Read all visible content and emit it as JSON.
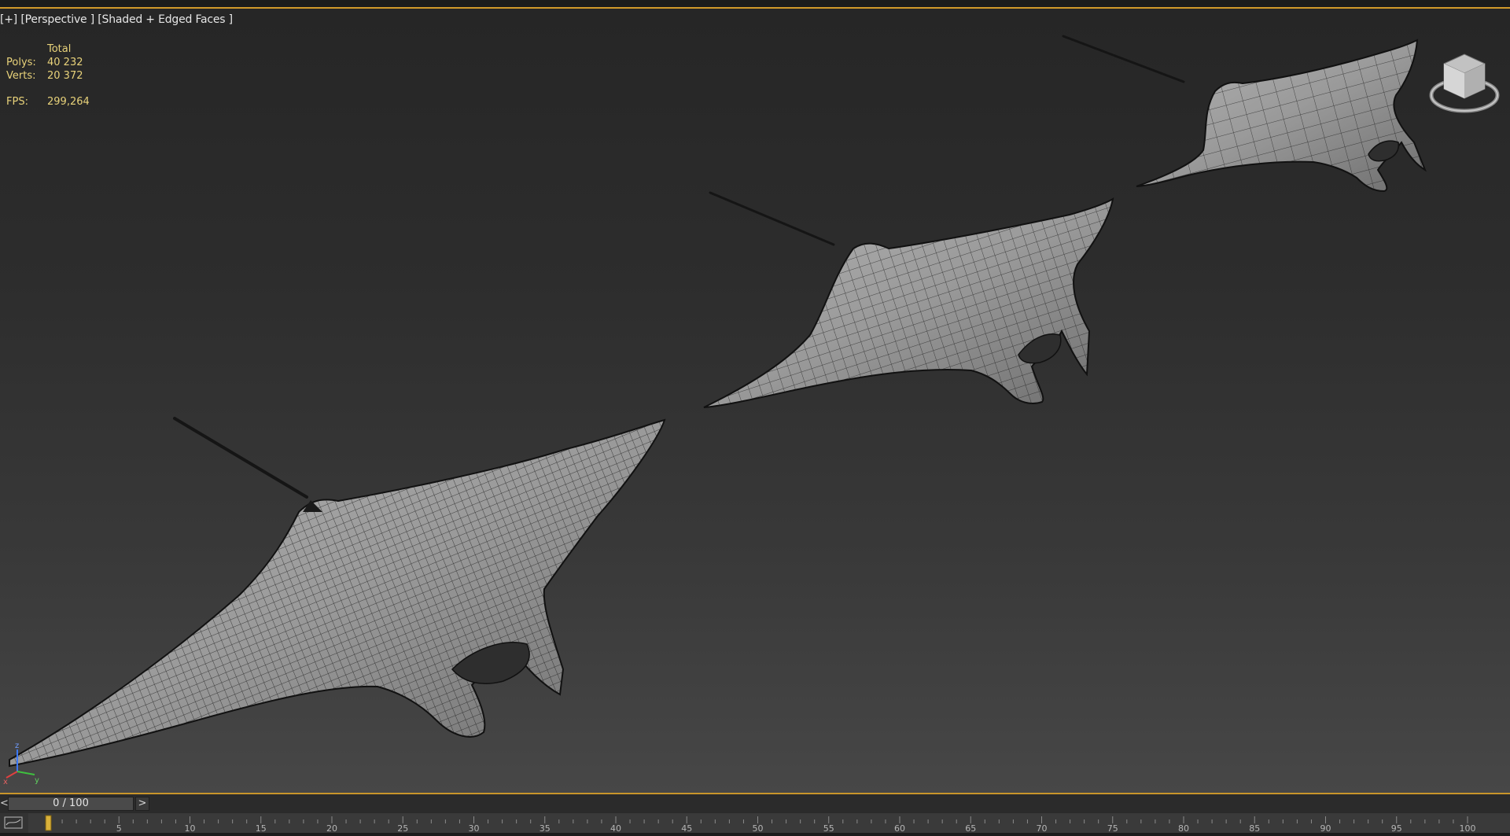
{
  "viewport": {
    "label_plus": "[+]",
    "label_view": "[Perspective ]",
    "label_shading": "[Shaded + Edged Faces ]"
  },
  "stats": {
    "header": "Total",
    "polys_label": "Polys:",
    "polys_value": "40 232",
    "verts_label": "Verts:",
    "verts_value": "20 372",
    "fps_label": "FPS:",
    "fps_value": "299,264"
  },
  "axis": {
    "z": "z",
    "x": "x",
    "y": "y"
  },
  "timeslider": {
    "prev": "<",
    "value": "0 / 100",
    "next": ">"
  },
  "trackbar": {
    "ticks": [
      "5",
      "10",
      "15",
      "20",
      "25",
      "30",
      "35",
      "40",
      "45",
      "50",
      "55",
      "60",
      "65",
      "70",
      "75",
      "80",
      "85",
      "90",
      "95",
      "100"
    ]
  },
  "colors": {
    "accent": "#d29a2a",
    "stats_text": "#e8d27a",
    "mesh_fill": "#9d9d9d",
    "wire": "#1b1b1b"
  }
}
